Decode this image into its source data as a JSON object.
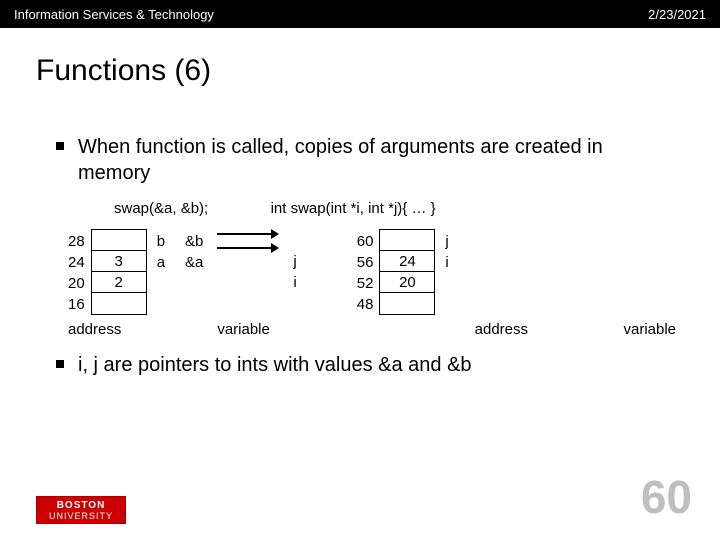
{
  "header": {
    "org": "Information Services & Technology",
    "date": "2/23/2021"
  },
  "title": "Functions (6)",
  "bullet1": "When function is called, copies of arguments are created in memory",
  "codeline": {
    "call": "swap(&a, &b);",
    "sig": "int swap(int *i,  int *j){  …  }"
  },
  "diagram": {
    "left": {
      "addr": [
        "28",
        "24",
        "20",
        "16"
      ],
      "cells": [
        "",
        "3",
        "2",
        ""
      ],
      "vars": [
        "",
        "b",
        "a",
        ""
      ],
      "amps": [
        "",
        "&b",
        "&a",
        ""
      ]
    },
    "right": {
      "ptrs": [
        "j",
        "i"
      ],
      "addr": [
        "60",
        "56",
        "52",
        "48"
      ],
      "cells": [
        "",
        "24",
        "20",
        ""
      ],
      "vars": [
        "",
        "j",
        "i",
        ""
      ]
    },
    "labels": {
      "address": "address",
      "variable": "variable"
    }
  },
  "bullet2": "i, j are pointers to ints with values &a and &b",
  "logo": {
    "line1": "BOSTON",
    "line2": "UNIVERSITY"
  },
  "pageNum": "60"
}
